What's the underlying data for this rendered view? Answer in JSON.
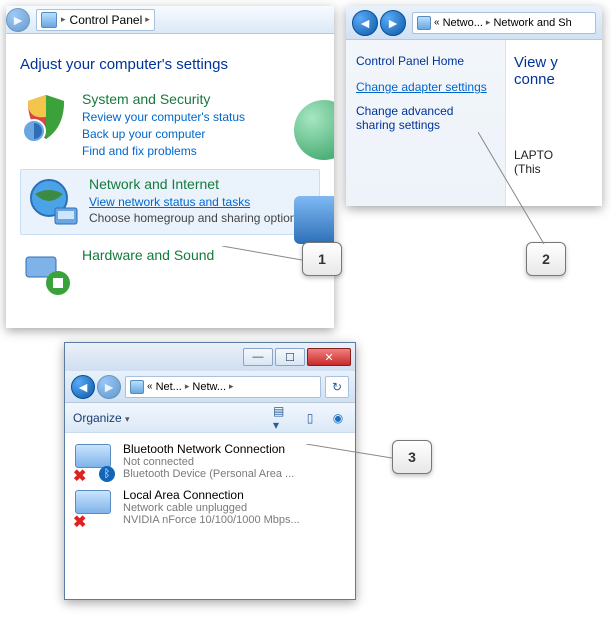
{
  "panel1": {
    "breadcrumb": "Control Panel",
    "heading": "Adjust your computer's settings",
    "cat_security": {
      "title": "System and Security",
      "l1": "Review your computer's status",
      "l2": "Back up your computer",
      "l3": "Find and fix problems"
    },
    "cat_network": {
      "title": "Network and Internet",
      "link": "View network status and tasks",
      "desc": "Choose homegroup and sharing options"
    },
    "cat_hardware": {
      "title": "Hardware and Sound"
    }
  },
  "panel2": {
    "crumb1": "Netwo...",
    "crumb2": "Network and Sh",
    "side_heading": "Control Panel Home",
    "side_link1": "Change adapter settings",
    "side_link2": "Change advanced sharing settings",
    "main_heading": "View y",
    "main_heading2": "conne",
    "laptop": "LAPTO",
    "this": "(This"
  },
  "panel3": {
    "crumb1": "Net...",
    "crumb2": "Netw...",
    "organize": "Organize",
    "conn1": {
      "name": "Bluetooth Network Connection",
      "status": "Not connected",
      "device": "Bluetooth Device (Personal Area ..."
    },
    "conn2": {
      "name": "Local Area Connection",
      "status": "Network cable unplugged",
      "device": "NVIDIA nForce 10/100/1000 Mbps..."
    }
  },
  "callouts": {
    "c1": "1",
    "c2": "2",
    "c3": "3"
  }
}
